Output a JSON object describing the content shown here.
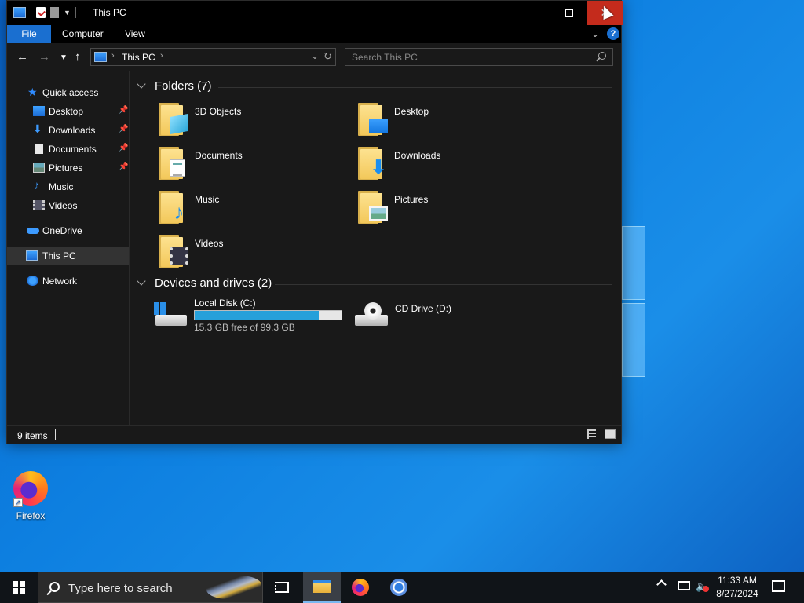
{
  "window": {
    "title": "This PC",
    "close_glyph": "✕"
  },
  "ribbon": {
    "tabs": [
      "File",
      "Computer",
      "View"
    ]
  },
  "address": {
    "path": "This PC",
    "search_placeholder": "Search This PC"
  },
  "nav_pane": {
    "items": [
      {
        "label": "Quick access",
        "icon": "star-icon"
      },
      {
        "label": "Desktop",
        "icon": "desktop-icon",
        "pinned": true
      },
      {
        "label": "Downloads",
        "icon": "download-arrow-icon",
        "pinned": true
      },
      {
        "label": "Documents",
        "icon": "document-icon",
        "pinned": true
      },
      {
        "label": "Pictures",
        "icon": "pictures-icon",
        "pinned": true
      },
      {
        "label": "Music",
        "icon": "music-note-icon"
      },
      {
        "label": "Videos",
        "icon": "video-icon"
      },
      {
        "label": "OneDrive",
        "icon": "cloud-icon"
      },
      {
        "label": "This PC",
        "icon": "computer-icon",
        "selected": true
      },
      {
        "label": "Network",
        "icon": "network-icon"
      }
    ]
  },
  "content": {
    "folders_header": "Folders (7)",
    "folders": [
      {
        "label": "3D Objects",
        "icon": "3d-objects-folder-icon"
      },
      {
        "label": "Desktop",
        "icon": "desktop-folder-icon"
      },
      {
        "label": "Documents",
        "icon": "documents-folder-icon"
      },
      {
        "label": "Downloads",
        "icon": "downloads-folder-icon"
      },
      {
        "label": "Music",
        "icon": "music-folder-icon"
      },
      {
        "label": "Pictures",
        "icon": "pictures-folder-icon"
      },
      {
        "label": "Videos",
        "icon": "videos-folder-icon"
      }
    ],
    "drives_header": "Devices and drives (2)",
    "drives": [
      {
        "label": "Local Disk (C:)",
        "free_text": "15.3 GB free of 99.3 GB",
        "used_fraction": 0.846
      },
      {
        "label": "CD Drive (D:)"
      }
    ]
  },
  "status": {
    "item_count": "9 items"
  },
  "desktop": {
    "icons": [
      {
        "label": "Firefox"
      }
    ]
  },
  "taskbar": {
    "search_placeholder": "Type here to search",
    "time": "11:33 AM",
    "date": "8/27/2024"
  },
  "colors": {
    "accent": "#1a6fd0",
    "close_red": "#c42b1c",
    "capacity_bar": "#26a0da",
    "window_bg": "#191919"
  }
}
